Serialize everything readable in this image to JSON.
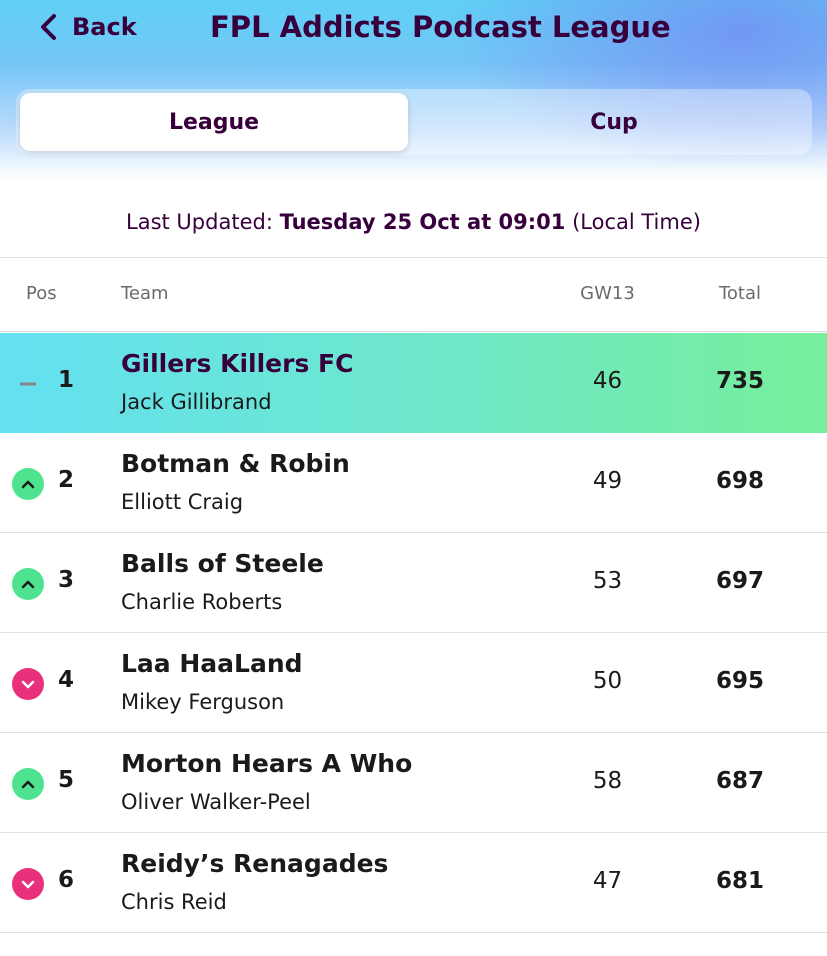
{
  "header": {
    "back_label": "Back",
    "title": "FPL Addicts Podcast League"
  },
  "tabs": [
    {
      "label": "League",
      "active": true
    },
    {
      "label": "Cup",
      "active": false
    }
  ],
  "last_updated": {
    "prefix": "Last Updated: ",
    "datetime": "Tuesday 25 Oct at 09:01",
    "suffix": " (Local Time)"
  },
  "table": {
    "columns": [
      "Pos",
      "Team",
      "GW13",
      "Total"
    ],
    "rows": [
      {
        "movement": "same",
        "pos": "1",
        "team": "Gillers Killers FC",
        "manager": "Jack Gillibrand",
        "gw": "46",
        "total": "735"
      },
      {
        "movement": "up",
        "pos": "2",
        "team": "Botman & Robin",
        "manager": "Elliott Craig",
        "gw": "49",
        "total": "698"
      },
      {
        "movement": "up",
        "pos": "3",
        "team": "Balls of Steele",
        "manager": "Charlie Roberts",
        "gw": "53",
        "total": "697"
      },
      {
        "movement": "down",
        "pos": "4",
        "team": "Laa HaaLand",
        "manager": "Mikey Ferguson",
        "gw": "50",
        "total": "695"
      },
      {
        "movement": "up",
        "pos": "5",
        "team": "Morton Hears A Who",
        "manager": "Oliver Walker-Peel",
        "gw": "58",
        "total": "687"
      },
      {
        "movement": "down",
        "pos": "6",
        "team": "Reidy’s Renagades",
        "manager": "Chris Reid",
        "gw": "47",
        "total": "681"
      }
    ]
  },
  "colors": {
    "brand_purple": "#37003c",
    "up": "#4fe38f",
    "down": "#e9307a"
  }
}
